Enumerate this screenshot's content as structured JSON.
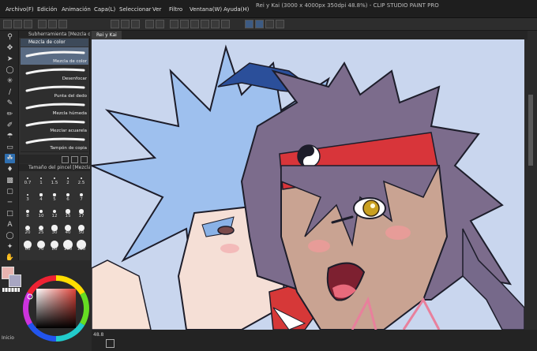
{
  "app": {
    "title": "Rei y Kai (3000 x 4000px 350dpi 48.8%) - CLIP STUDIO PAINT PRO"
  },
  "menu": [
    "Archivo(F)",
    "Edición",
    "Animación",
    "Capa(L)",
    "Seleccionar",
    "Ver",
    "Filtro",
    "Ventana(W)",
    "Ayuda(H)"
  ],
  "sub_tool_panel": {
    "tab_label": "Subherramienta [Mezcla de color]",
    "header_label": "Mezcla de color",
    "brushes": [
      {
        "label": "Mezcla de color",
        "selected": true
      },
      {
        "label": "Desenfocar",
        "selected": false
      },
      {
        "label": "Punta del dedo",
        "selected": false
      },
      {
        "label": "Mezcla húmeda",
        "selected": false
      },
      {
        "label": "Mezclar acuarela",
        "selected": false
      },
      {
        "label": "Tampón de copia",
        "selected": false
      }
    ]
  },
  "brush_size_panel": {
    "tab_label": "Tamaño del pincel [Mezcla de color]",
    "sizes": [
      "0.7",
      "1",
      "1.5",
      "2",
      "2.5",
      "3",
      "4",
      "5",
      "6",
      "7",
      "8",
      "10",
      "12",
      "15",
      "17",
      "20",
      "25",
      "30",
      "40",
      "50",
      "60",
      "70",
      "80",
      "100",
      "120"
    ]
  },
  "document_tab": {
    "label": "Rei y Kai"
  },
  "status_bar": {
    "zoom": "48.8",
    "home_label": "Inicio"
  },
  "colors": {
    "main_color": "#e8b4b0",
    "sub_color": "#a8a6c2",
    "canvas_bg": "#c9d6ee",
    "selection_blue": "#2f6fb0"
  }
}
